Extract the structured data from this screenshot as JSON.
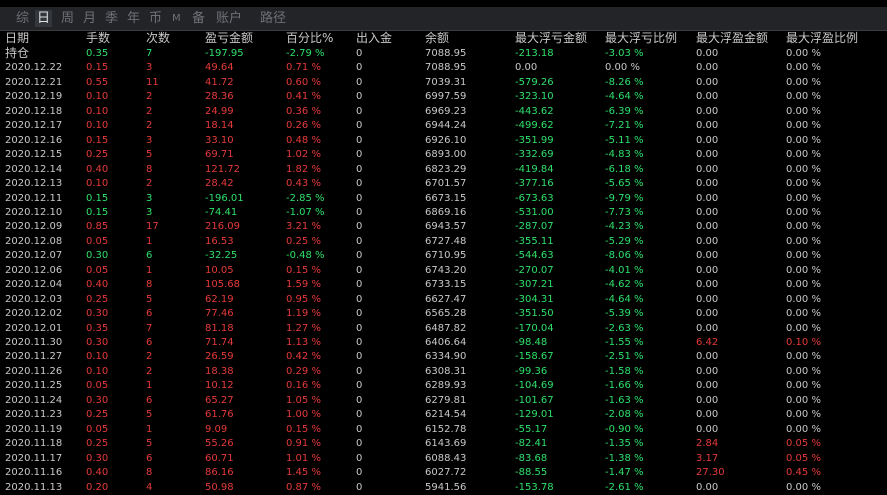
{
  "tabs": [
    {
      "label": "综",
      "active": false
    },
    {
      "label": "日",
      "active": true
    },
    {
      "label": "周",
      "active": false
    },
    {
      "label": "月",
      "active": false
    },
    {
      "label": "季",
      "active": false
    },
    {
      "label": "年",
      "active": false
    },
    {
      "label": "币",
      "active": false
    },
    {
      "label": "M",
      "active": false
    },
    {
      "label": "备",
      "active": false
    },
    {
      "label": "账户",
      "active": false
    },
    {
      "label": "路径",
      "active": false
    }
  ],
  "columns": [
    "日期",
    "手数",
    "次数",
    "盈亏金额",
    "百分比%",
    "出入金",
    "余额",
    "最大浮亏金额",
    "最大浮亏比例",
    "最大浮盈金额",
    "最大浮盈比例"
  ],
  "rows": [
    {
      "date": "持仓",
      "lots": "0.35",
      "count": "7",
      "pnl": "-197.95",
      "pct": "-2.79 %",
      "flow": "0",
      "balance": "7088.95",
      "maxloss": "-213.18",
      "maxlosspct": "-3.03 %",
      "maxgain": "0.00",
      "maxgainpct": "0.00 %"
    },
    {
      "date": "2020.12.22",
      "lots": "0.15",
      "count": "3",
      "pnl": "49.64",
      "pct": "0.71 %",
      "flow": "0",
      "balance": "7088.95",
      "maxloss": "0.00",
      "maxlosspct": "0.00 %",
      "maxgain": "0.00",
      "maxgainpct": "0.00 %"
    },
    {
      "date": "2020.12.21",
      "lots": "0.55",
      "count": "11",
      "pnl": "41.72",
      "pct": "0.60 %",
      "flow": "0",
      "balance": "7039.31",
      "maxloss": "-579.26",
      "maxlosspct": "-8.26 %",
      "maxgain": "0.00",
      "maxgainpct": "0.00 %"
    },
    {
      "date": "2020.12.19",
      "lots": "0.10",
      "count": "2",
      "pnl": "28.36",
      "pct": "0.41 %",
      "flow": "0",
      "balance": "6997.59",
      "maxloss": "-323.10",
      "maxlosspct": "-4.64 %",
      "maxgain": "0.00",
      "maxgainpct": "0.00 %"
    },
    {
      "date": "2020.12.18",
      "lots": "0.10",
      "count": "2",
      "pnl": "24.99",
      "pct": "0.36 %",
      "flow": "0",
      "balance": "6969.23",
      "maxloss": "-443.62",
      "maxlosspct": "-6.39 %",
      "maxgain": "0.00",
      "maxgainpct": "0.00 %"
    },
    {
      "date": "2020.12.17",
      "lots": "0.10",
      "count": "2",
      "pnl": "18.14",
      "pct": "0.26 %",
      "flow": "0",
      "balance": "6944.24",
      "maxloss": "-499.62",
      "maxlosspct": "-7.21 %",
      "maxgain": "0.00",
      "maxgainpct": "0.00 %"
    },
    {
      "date": "2020.12.16",
      "lots": "0.15",
      "count": "3",
      "pnl": "33.10",
      "pct": "0.48 %",
      "flow": "0",
      "balance": "6926.10",
      "maxloss": "-351.99",
      "maxlosspct": "-5.11 %",
      "maxgain": "0.00",
      "maxgainpct": "0.00 %"
    },
    {
      "date": "2020.12.15",
      "lots": "0.25",
      "count": "5",
      "pnl": "69.71",
      "pct": "1.02 %",
      "flow": "0",
      "balance": "6893.00",
      "maxloss": "-332.69",
      "maxlosspct": "-4.83 %",
      "maxgain": "0.00",
      "maxgainpct": "0.00 %"
    },
    {
      "date": "2020.12.14",
      "lots": "0.40",
      "count": "8",
      "pnl": "121.72",
      "pct": "1.82 %",
      "flow": "0",
      "balance": "6823.29",
      "maxloss": "-419.84",
      "maxlosspct": "-6.18 %",
      "maxgain": "0.00",
      "maxgainpct": "0.00 %"
    },
    {
      "date": "2020.12.13",
      "lots": "0.10",
      "count": "2",
      "pnl": "28.42",
      "pct": "0.43 %",
      "flow": "0",
      "balance": "6701.57",
      "maxloss": "-377.16",
      "maxlosspct": "-5.65 %",
      "maxgain": "0.00",
      "maxgainpct": "0.00 %"
    },
    {
      "date": "2020.12.11",
      "lots": "0.15",
      "count": "3",
      "pnl": "-196.01",
      "pct": "-2.85 %",
      "flow": "0",
      "balance": "6673.15",
      "maxloss": "-673.63",
      "maxlosspct": "-9.79 %",
      "maxgain": "0.00",
      "maxgainpct": "0.00 %"
    },
    {
      "date": "2020.12.10",
      "lots": "0.15",
      "count": "3",
      "pnl": "-74.41",
      "pct": "-1.07 %",
      "flow": "0",
      "balance": "6869.16",
      "maxloss": "-531.00",
      "maxlosspct": "-7.73 %",
      "maxgain": "0.00",
      "maxgainpct": "0.00 %"
    },
    {
      "date": "2020.12.09",
      "lots": "0.85",
      "count": "17",
      "pnl": "216.09",
      "pct": "3.21 %",
      "flow": "0",
      "balance": "6943.57",
      "maxloss": "-287.07",
      "maxlosspct": "-4.23 %",
      "maxgain": "0.00",
      "maxgainpct": "0.00 %"
    },
    {
      "date": "2020.12.08",
      "lots": "0.05",
      "count": "1",
      "pnl": "16.53",
      "pct": "0.25 %",
      "flow": "0",
      "balance": "6727.48",
      "maxloss": "-355.11",
      "maxlosspct": "-5.29 %",
      "maxgain": "0.00",
      "maxgainpct": "0.00 %"
    },
    {
      "date": "2020.12.07",
      "lots": "0.30",
      "count": "6",
      "pnl": "-32.25",
      "pct": "-0.48 %",
      "flow": "0",
      "balance": "6710.95",
      "maxloss": "-544.63",
      "maxlosspct": "-8.06 %",
      "maxgain": "0.00",
      "maxgainpct": "0.00 %"
    },
    {
      "date": "2020.12.06",
      "lots": "0.05",
      "count": "1",
      "pnl": "10.05",
      "pct": "0.15 %",
      "flow": "0",
      "balance": "6743.20",
      "maxloss": "-270.07",
      "maxlosspct": "-4.01 %",
      "maxgain": "0.00",
      "maxgainpct": "0.00 %"
    },
    {
      "date": "2020.12.04",
      "lots": "0.40",
      "count": "8",
      "pnl": "105.68",
      "pct": "1.59 %",
      "flow": "0",
      "balance": "6733.15",
      "maxloss": "-307.21",
      "maxlosspct": "-4.62 %",
      "maxgain": "0.00",
      "maxgainpct": "0.00 %"
    },
    {
      "date": "2020.12.03",
      "lots": "0.25",
      "count": "5",
      "pnl": "62.19",
      "pct": "0.95 %",
      "flow": "0",
      "balance": "6627.47",
      "maxloss": "-304.31",
      "maxlosspct": "-4.64 %",
      "maxgain": "0.00",
      "maxgainpct": "0.00 %"
    },
    {
      "date": "2020.12.02",
      "lots": "0.30",
      "count": "6",
      "pnl": "77.46",
      "pct": "1.19 %",
      "flow": "0",
      "balance": "6565.28",
      "maxloss": "-351.50",
      "maxlosspct": "-5.39 %",
      "maxgain": "0.00",
      "maxgainpct": "0.00 %"
    },
    {
      "date": "2020.12.01",
      "lots": "0.35",
      "count": "7",
      "pnl": "81.18",
      "pct": "1.27 %",
      "flow": "0",
      "balance": "6487.82",
      "maxloss": "-170.04",
      "maxlosspct": "-2.63 %",
      "maxgain": "0.00",
      "maxgainpct": "0.00 %"
    },
    {
      "date": "2020.11.30",
      "lots": "0.30",
      "count": "6",
      "pnl": "71.74",
      "pct": "1.13 %",
      "flow": "0",
      "balance": "6406.64",
      "maxloss": "-98.48",
      "maxlosspct": "-1.55 %",
      "maxgain": "6.42",
      "maxgainpct": "0.10 %"
    },
    {
      "date": "2020.11.27",
      "lots": "0.10",
      "count": "2",
      "pnl": "26.59",
      "pct": "0.42 %",
      "flow": "0",
      "balance": "6334.90",
      "maxloss": "-158.67",
      "maxlosspct": "-2.51 %",
      "maxgain": "0.00",
      "maxgainpct": "0.00 %"
    },
    {
      "date": "2020.11.26",
      "lots": "0.10",
      "count": "2",
      "pnl": "18.38",
      "pct": "0.29 %",
      "flow": "0",
      "balance": "6308.31",
      "maxloss": "-99.36",
      "maxlosspct": "-1.58 %",
      "maxgain": "0.00",
      "maxgainpct": "0.00 %"
    },
    {
      "date": "2020.11.25",
      "lots": "0.05",
      "count": "1",
      "pnl": "10.12",
      "pct": "0.16 %",
      "flow": "0",
      "balance": "6289.93",
      "maxloss": "-104.69",
      "maxlosspct": "-1.66 %",
      "maxgain": "0.00",
      "maxgainpct": "0.00 %"
    },
    {
      "date": "2020.11.24",
      "lots": "0.30",
      "count": "6",
      "pnl": "65.27",
      "pct": "1.05 %",
      "flow": "0",
      "balance": "6279.81",
      "maxloss": "-101.67",
      "maxlosspct": "-1.63 %",
      "maxgain": "0.00",
      "maxgainpct": "0.00 %"
    },
    {
      "date": "2020.11.23",
      "lots": "0.25",
      "count": "5",
      "pnl": "61.76",
      "pct": "1.00 %",
      "flow": "0",
      "balance": "6214.54",
      "maxloss": "-129.01",
      "maxlosspct": "-2.08 %",
      "maxgain": "0.00",
      "maxgainpct": "0.00 %"
    },
    {
      "date": "2020.11.19",
      "lots": "0.05",
      "count": "1",
      "pnl": "9.09",
      "pct": "0.15 %",
      "flow": "0",
      "balance": "6152.78",
      "maxloss": "-55.17",
      "maxlosspct": "-0.90 %",
      "maxgain": "0.00",
      "maxgainpct": "0.00 %"
    },
    {
      "date": "2020.11.18",
      "lots": "0.25",
      "count": "5",
      "pnl": "55.26",
      "pct": "0.91 %",
      "flow": "0",
      "balance": "6143.69",
      "maxloss": "-82.41",
      "maxlosspct": "-1.35 %",
      "maxgain": "2.84",
      "maxgainpct": "0.05 %"
    },
    {
      "date": "2020.11.17",
      "lots": "0.30",
      "count": "6",
      "pnl": "60.71",
      "pct": "1.01 %",
      "flow": "0",
      "balance": "6088.43",
      "maxloss": "-83.68",
      "maxlosspct": "-1.38 %",
      "maxgain": "3.17",
      "maxgainpct": "0.05 %"
    },
    {
      "date": "2020.11.16",
      "lots": "0.40",
      "count": "8",
      "pnl": "86.16",
      "pct": "1.45 %",
      "flow": "0",
      "balance": "6027.72",
      "maxloss": "-88.55",
      "maxlosspct": "-1.47 %",
      "maxgain": "27.30",
      "maxgainpct": "0.45 %"
    },
    {
      "date": "2020.11.13",
      "lots": "0.20",
      "count": "4",
      "pnl": "50.98",
      "pct": "0.87 %",
      "flow": "0",
      "balance": "5941.56",
      "maxloss": "-153.78",
      "maxlosspct": "-2.61 %",
      "maxgain": "0.00",
      "maxgainpct": "0.00 %"
    }
  ],
  "colors": {
    "profit": "#e53a3a",
    "loss": "#2ee06a",
    "neutral": "#c8c8c8",
    "background": "#000000"
  }
}
